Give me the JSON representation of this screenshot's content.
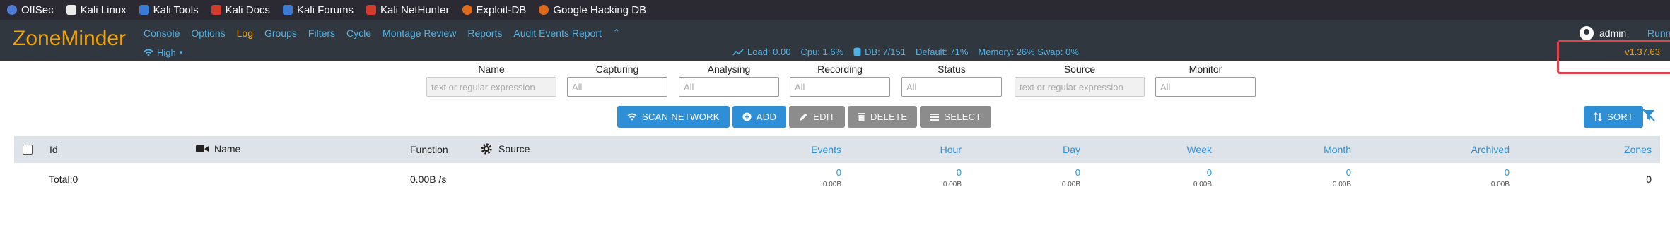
{
  "bookmarks": [
    {
      "label": "OffSec",
      "icon": "offsec-icon",
      "color": "#4d7bd6"
    },
    {
      "label": "Kali Linux",
      "icon": "kali-dragon-icon",
      "color": "#eaeaea"
    },
    {
      "label": "Kali Tools",
      "icon": "kali-tools-icon",
      "color": "#3a7bd5"
    },
    {
      "label": "Kali Docs",
      "icon": "kali-docs-icon",
      "color": "#d6392e"
    },
    {
      "label": "Kali Forums",
      "icon": "kali-forums-icon",
      "color": "#3a7bd5"
    },
    {
      "label": "Kali NetHunter",
      "icon": "nethunter-icon",
      "color": "#d6392e"
    },
    {
      "label": "Exploit-DB",
      "icon": "exploit-db-icon",
      "color": "#e06a1b"
    },
    {
      "label": "Google Hacking DB",
      "icon": "ghdb-icon",
      "color": "#e06a1b"
    }
  ],
  "header": {
    "logo": "ZoneMinder",
    "nav": [
      "Console",
      "Options",
      "Log",
      "Groups",
      "Filters",
      "Cycle",
      "Montage Review",
      "Reports",
      "Audit Events Report"
    ],
    "active_nav": "Log",
    "bandwidth": "High",
    "stats": {
      "load": "Load: 0.00",
      "cpu": "Cpu: 1.6%",
      "db": "DB: 7/151",
      "default": "Default: 71%",
      "memory": "Memory: 26% Swap: 0%"
    },
    "user": "admin",
    "status": "Running",
    "version": "v1.37.63"
  },
  "filters": [
    {
      "label": "Name",
      "placeholder": "text or regular expression"
    },
    {
      "label": "Capturing",
      "placeholder": "All"
    },
    {
      "label": "Analysing",
      "placeholder": "All"
    },
    {
      "label": "Recording",
      "placeholder": "All"
    },
    {
      "label": "Status",
      "placeholder": "All"
    },
    {
      "label": "Source",
      "placeholder": "text or regular expression"
    },
    {
      "label": "Monitor",
      "placeholder": "All"
    }
  ],
  "actions": {
    "scan": "SCAN NETWORK",
    "add": "ADD",
    "edit": "EDIT",
    "delete": "DELETE",
    "select": "SELECT",
    "sort": "SORT"
  },
  "table": {
    "headers": {
      "id": "Id",
      "name": "Name",
      "function": "Function",
      "source": "Source",
      "events": "Events",
      "hour": "Hour",
      "day": "Day",
      "week": "Week",
      "month": "Month",
      "archived": "Archived",
      "zones": "Zones"
    },
    "total": {
      "label": "Total:0",
      "function": "0.00B /s",
      "events": {
        "count": "0",
        "size": "0.00B"
      },
      "hour": {
        "count": "0",
        "size": "0.00B"
      },
      "day": {
        "count": "0",
        "size": "0.00B"
      },
      "week": {
        "count": "0",
        "size": "0.00B"
      },
      "month": {
        "count": "0",
        "size": "0.00B"
      },
      "archived": {
        "count": "0",
        "size": "0.00B"
      },
      "zones": "0"
    }
  },
  "colors": {
    "accent": "#f0a30a",
    "link": "#4fb3e8",
    "primary": "#2e8fd6",
    "header_bg": "#30373e",
    "highlight": "#e0434b"
  }
}
